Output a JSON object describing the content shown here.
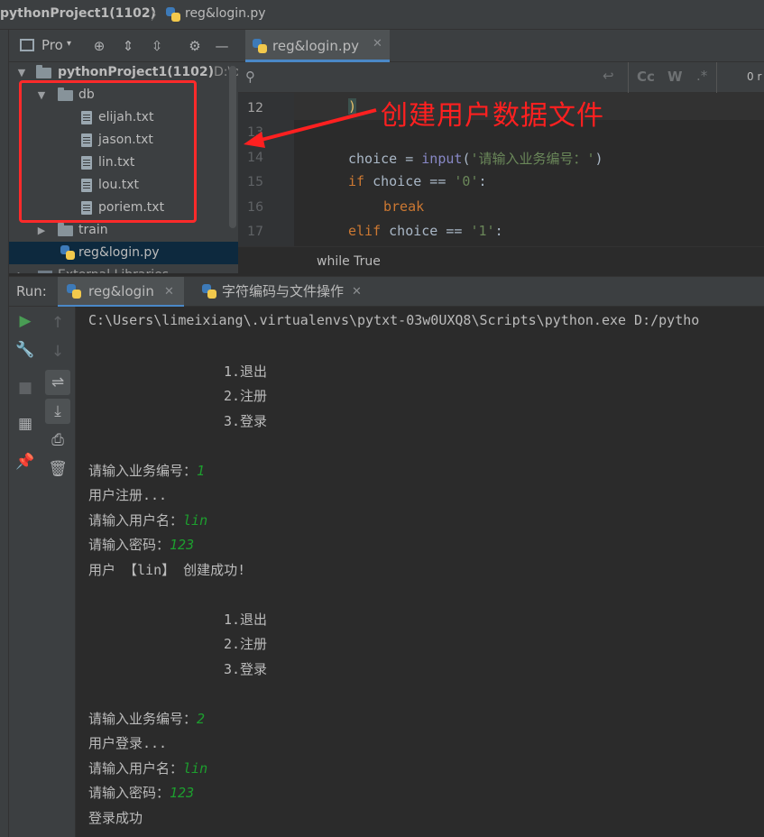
{
  "breadcrumb": {
    "project": "pythonProject1(1102)",
    "separator": "〉",
    "file": "reg&login.py"
  },
  "project_panel": {
    "title": "Pro",
    "root": {
      "name": "pythonProject1(1102)",
      "path_hint": "D:\\p"
    },
    "db_folder": "db",
    "db_files": [
      "elijah.txt",
      "jason.txt",
      "lin.txt",
      "lou.txt",
      "poriem.txt"
    ],
    "train_folder": "train",
    "file": "reg&login.py",
    "external": "External Libraries"
  },
  "editor": {
    "tab": "reg&login.py",
    "search_right": "0 r",
    "lines": [
      {
        "n": "12"
      },
      {
        "n": "13"
      },
      {
        "n": "14"
      },
      {
        "n": "15"
      },
      {
        "n": "16"
      },
      {
        "n": "17"
      }
    ],
    "code": {
      "l12": ")",
      "l14_a": "choice = ",
      "l14_fn": "input",
      "l14_b": "(",
      "l14_str": "'请输入业务编号：'",
      "l14_c": ")",
      "l15_kw": "if",
      "l15_a": " choice == ",
      "l15_str": "'0'",
      "l15_b": ":",
      "l16_kw": "break",
      "l17_kw": "elif",
      "l17_a": " choice == ",
      "l17_str": "'1'",
      "l17_b": ":"
    },
    "status": "while True"
  },
  "annotation": "创建用户数据文件",
  "run": {
    "label": "Run:",
    "tabs": [
      "reg&login",
      "字符编码与文件操作"
    ],
    "console": {
      "cmd": "C:\\Users\\limeixiang\\.virtualenvs\\pytxt-03w0UXQ8\\Scripts\\python.exe D:/pytho",
      "menu1": "1.退出",
      "menu2": "2.注册",
      "menu3": "3.登录",
      "prompt_op": "请输入业务编号：",
      "input_op1": "1",
      "reg_title": "用户注册...",
      "prompt_user": "请输入用户名：",
      "input_user": "lin",
      "prompt_pwd": "请输入密码：",
      "input_pwd": "123",
      "reg_ok": "用户 【lin】 创建成功!",
      "input_op2": "2",
      "login_title": "用户登录...",
      "login_ok": "登录成功"
    }
  },
  "colors": {
    "annotation": "#ff2020",
    "console_input": "#1d9e2e",
    "keyword": "#cc7832",
    "string": "#6a8759"
  }
}
